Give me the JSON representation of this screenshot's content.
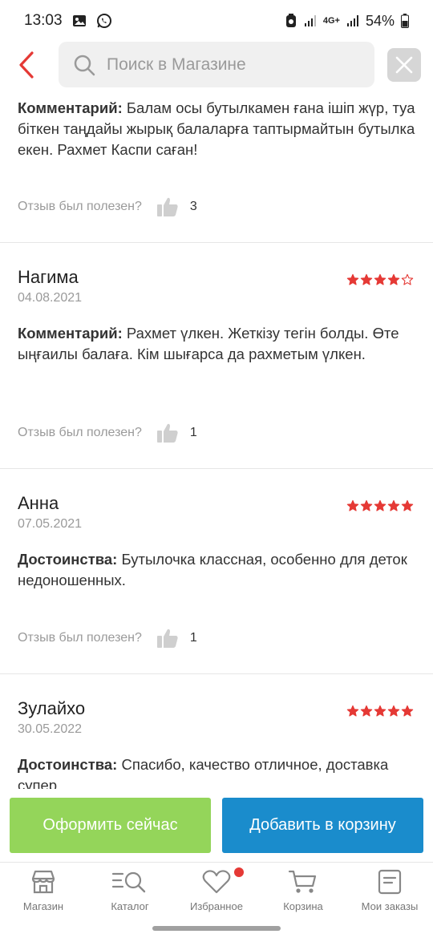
{
  "status": {
    "time": "13:03",
    "network": "4G+",
    "battery": "54%"
  },
  "search": {
    "placeholder": "Поиск в Магазине",
    "back_icon": "chevron-left-icon",
    "clear_icon": "close-icon"
  },
  "colors": {
    "accent_red": "#e53935",
    "star_red": "#e53935",
    "buy_green": "#94d55a",
    "cart_blue": "#1a8ccc"
  },
  "reviews": [
    {
      "name": "",
      "date": "",
      "rating": null,
      "label": "Комментарий:",
      "text": "Балам осы бутылкамен ғана ішіп жүр, туа біткен таңдайы жырық балаларға таптырмайтын бутылка екен. Рахмет Каспи саған!",
      "helpful_label": "Отзыв был полезен?",
      "helpful_count": "3"
    },
    {
      "name": "Нагима",
      "date": "04.08.2021",
      "rating": 4,
      "label": "Комментарий:",
      "text": "Рахмет үлкен. Жеткізу тегін болды. Өте ыңғаилы балаға. Кім шығарса да рахметым үлкен.",
      "helpful_label": "Отзыв был полезен?",
      "helpful_count": "1"
    },
    {
      "name": "Анна",
      "date": "07.05.2021",
      "rating": 5,
      "label": "Достоинства:",
      "text": "Бутылочка классная, особенно для деток недоношенных.",
      "helpful_label": "Отзыв был полезен?",
      "helpful_count": "1"
    },
    {
      "name": "Зулайхо",
      "date": "30.05.2022",
      "rating": 5,
      "label": "Достоинства:",
      "text": "Спасибо, качество отличное, доставка супер",
      "helpful_label": "",
      "helpful_count": ""
    }
  ],
  "actions": {
    "buy_now": "Оформить сейчас",
    "add_to_cart": "Добавить в корзину"
  },
  "nav": [
    {
      "label": "Магазин",
      "icon": "store-icon"
    },
    {
      "label": "Каталог",
      "icon": "catalog-search-icon"
    },
    {
      "label": "Избранное",
      "icon": "heart-icon"
    },
    {
      "label": "Корзина",
      "icon": "cart-icon"
    },
    {
      "label": "Мои заказы",
      "icon": "orders-icon"
    }
  ]
}
